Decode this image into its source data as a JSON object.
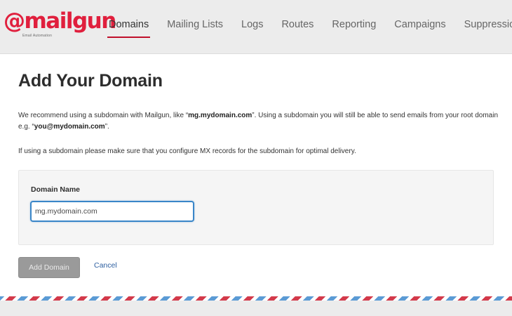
{
  "brand": {
    "logo_text": "@mailgun",
    "tagline": "Email Automation",
    "accent_color": "#e01f3d"
  },
  "nav": {
    "items": [
      {
        "label": "Domains",
        "active": true
      },
      {
        "label": "Mailing Lists"
      },
      {
        "label": "Logs"
      },
      {
        "label": "Routes"
      },
      {
        "label": "Reporting"
      },
      {
        "label": "Campaigns"
      },
      {
        "label": "Suppressions"
      }
    ]
  },
  "page": {
    "title": "Add Your Domain",
    "intro": {
      "a": "We recommend using a subdomain with Mailgun, like “",
      "b": "mg.mydomain.com",
      "c": "”. Using a subdomain you will still be able to send emails from your root domain e.g. “",
      "d": "you@mydomain.com",
      "e": "”."
    },
    "mx_note": "If using a subdomain please make sure that you configure MX records for the subdomain for optimal delivery."
  },
  "form": {
    "domain_label": "Domain Name",
    "domain_placeholder": "mg.mydomain.com",
    "domain_value": "",
    "add_button": "Add Domain",
    "cancel_link": "Cancel"
  }
}
